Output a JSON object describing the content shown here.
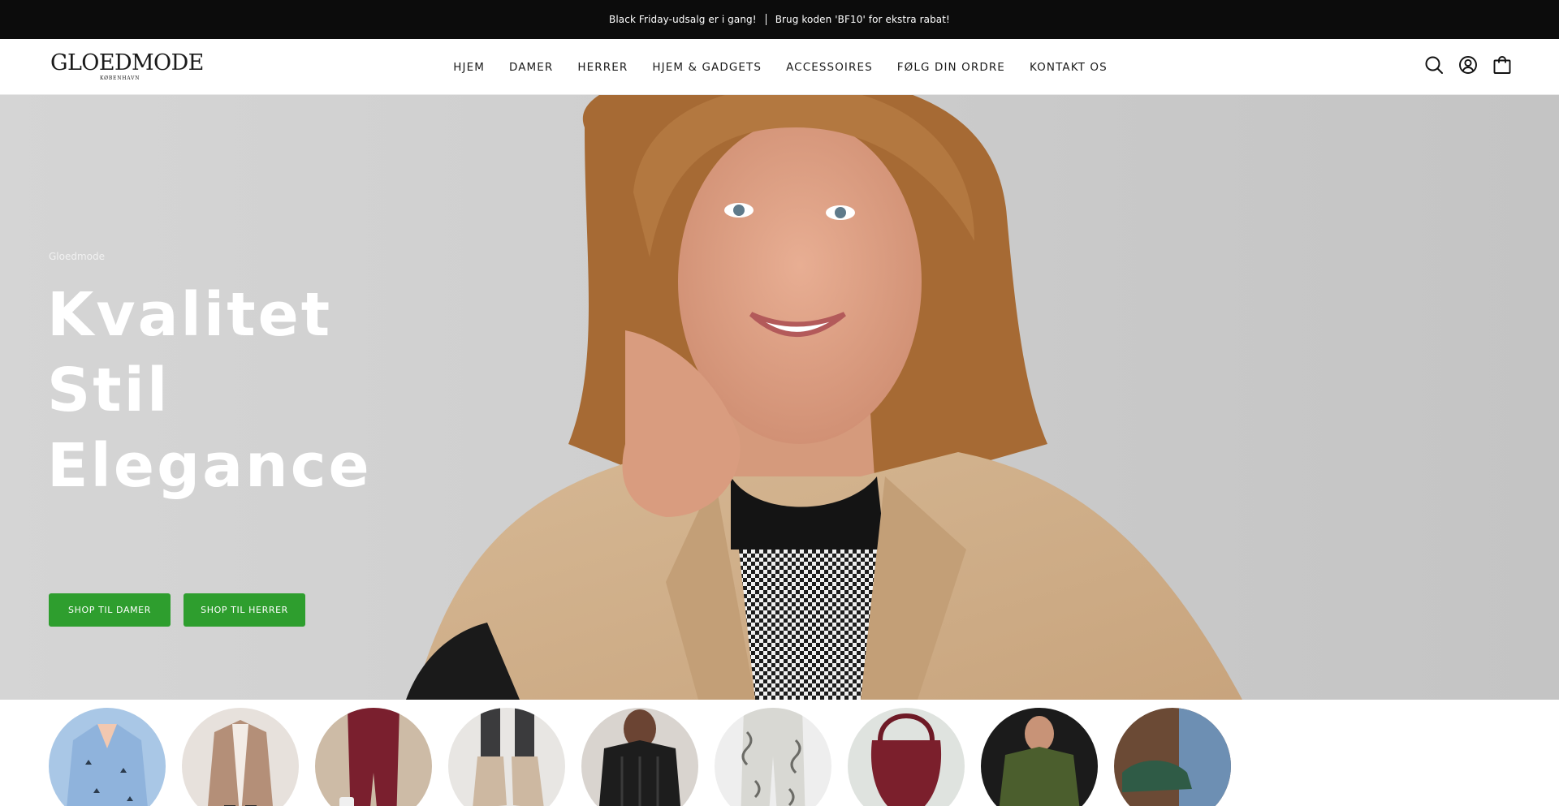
{
  "announcement": {
    "text_1": "Black Friday-udsalg er i gang!",
    "text_2": "Brug koden 'BF10' for ekstra rabat!",
    "background": "#0c0c0c"
  },
  "header": {
    "logo_text": "GLOEDMODE",
    "logo_sub": "KØBENHAVN",
    "nav": [
      {
        "label": "HJEM"
      },
      {
        "label": "DAMER"
      },
      {
        "label": "HERRER"
      },
      {
        "label": "HJEM & GADGETS"
      },
      {
        "label": "ACCESSOIRES"
      },
      {
        "label": "FØLG DIN ORDRE"
      },
      {
        "label": "KONTAKT OS"
      }
    ],
    "icons": [
      "search-icon",
      "account-icon",
      "cart-icon"
    ]
  },
  "hero": {
    "eyebrow": "Gloedmode",
    "title_lines": [
      "Kvalitet",
      "Stil",
      "Elegance"
    ],
    "buttons": [
      {
        "label": "SHOP TIL DAMER"
      },
      {
        "label": "SHOP TIL HERRER"
      }
    ],
    "button_color": "#2e9e2e"
  },
  "categories": [
    {
      "icon": "shirt-category-image"
    },
    {
      "icon": "coat-category-image"
    },
    {
      "icon": "jumpsuit-category-image"
    },
    {
      "icon": "boots-category-image"
    },
    {
      "icon": "knit-sweater-category-image"
    },
    {
      "icon": "pants-category-image"
    },
    {
      "icon": "handbag-category-image"
    },
    {
      "icon": "mens-sweater-category-image"
    },
    {
      "icon": "mens-shoes-category-image"
    }
  ]
}
